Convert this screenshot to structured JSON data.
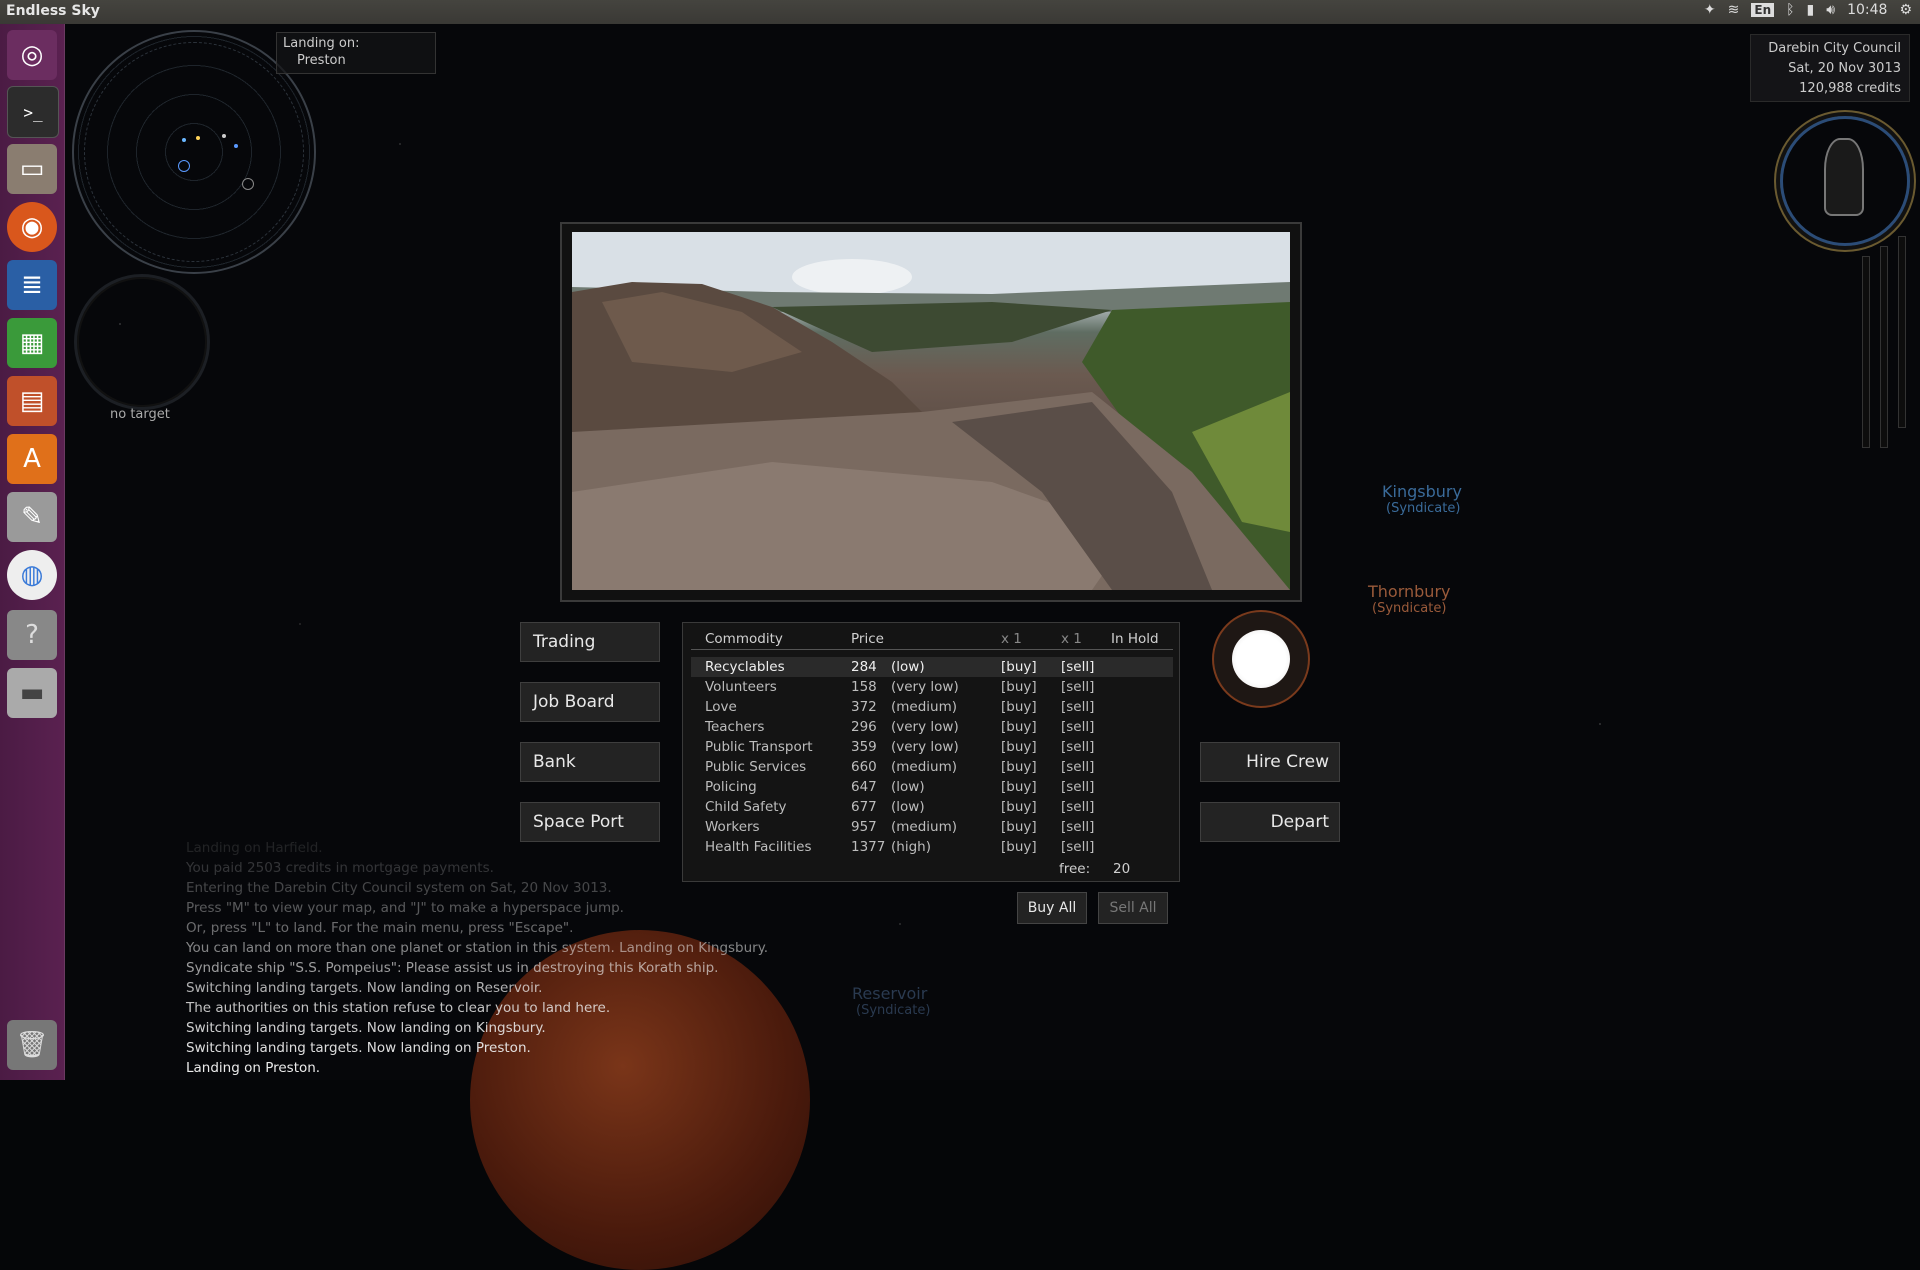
{
  "window": {
    "title": "Endless Sky"
  },
  "tray": {
    "keyboard": "En",
    "time": "10:48"
  },
  "launcher": {
    "items": [
      "ubuntu-home",
      "terminal",
      "files",
      "firefox",
      "writer",
      "calc",
      "impress",
      "software-center",
      "system-settings",
      "chrome",
      "help",
      "drive",
      "trash"
    ]
  },
  "hud": {
    "landing_label": "Landing on:",
    "landing_target": "Preston",
    "no_target": "no target",
    "system": "Darebin City Council",
    "date": "Sat, 20 Nov 3013",
    "credits": "120,988 credits"
  },
  "map_labels": [
    {
      "name": "Kingsbury",
      "gov": "(Syndicate)",
      "color": "#3a6b9a"
    },
    {
      "name": "Thornbury",
      "gov": "(Syndicate)",
      "color": "#9a5a3a"
    },
    {
      "name": "Reservoir",
      "gov": "(Syndicate)",
      "color": "#2a3a50"
    }
  ],
  "menu": {
    "trading": "Trading",
    "job_board": "Job Board",
    "bank": "Bank",
    "space_port": "Space Port",
    "hire_crew": "Hire Crew",
    "depart": "Depart"
  },
  "trade": {
    "headers": {
      "commodity": "Commodity",
      "price": "Price",
      "buy_qty": "x 1",
      "sell_qty": "x 1",
      "in_hold": "In Hold"
    },
    "rows": [
      {
        "name": "Recyclables",
        "price": "284",
        "level": "(low)",
        "buy": "[buy]",
        "sell": "[sell]"
      },
      {
        "name": "Volunteers",
        "price": "158",
        "level": "(very low)",
        "buy": "[buy]",
        "sell": "[sell]"
      },
      {
        "name": "Love",
        "price": "372",
        "level": "(medium)",
        "buy": "[buy]",
        "sell": "[sell]"
      },
      {
        "name": "Teachers",
        "price": "296",
        "level": "(very low)",
        "buy": "[buy]",
        "sell": "[sell]"
      },
      {
        "name": "Public Transport",
        "price": "359",
        "level": "(very low)",
        "buy": "[buy]",
        "sell": "[sell]"
      },
      {
        "name": "Public Services",
        "price": "660",
        "level": "(medium)",
        "buy": "[buy]",
        "sell": "[sell]"
      },
      {
        "name": "Policing",
        "price": "647",
        "level": "(low)",
        "buy": "[buy]",
        "sell": "[sell]"
      },
      {
        "name": "Child Safety",
        "price": "677",
        "level": "(low)",
        "buy": "[buy]",
        "sell": "[sell]"
      },
      {
        "name": "Workers",
        "price": "957",
        "level": "(medium)",
        "buy": "[buy]",
        "sell": "[sell]"
      },
      {
        "name": "Health Facilities",
        "price": "1377",
        "level": "(high)",
        "buy": "[buy]",
        "sell": "[sell]"
      }
    ],
    "free_label": "free:",
    "free_value": "20",
    "buy_all": "Buy All",
    "sell_all": "Sell All"
  },
  "log": [
    {
      "text": "Landing on Harfield.",
      "opacity": 0.12
    },
    {
      "text": "You paid 2503 credits in mortgage payments.",
      "opacity": 0.2
    },
    {
      "text": "Entering the Darebin City Council system on Sat, 20 Nov 3013.",
      "opacity": 0.28
    },
    {
      "text": "Press \"M\" to view your map, and \"J\" to make a hyperspace jump.",
      "opacity": 0.36
    },
    {
      "text": "Or, press \"L\" to land. For the main menu, press \"Escape\".",
      "opacity": 0.44
    },
    {
      "text": "You can land on more than one planet or station in this system. Landing on Kingsbury.",
      "opacity": 0.55
    },
    {
      "text": "Syndicate ship \"S.S. Pompeius\": Please assist us in destroying this Korath ship.",
      "opacity": 0.65
    },
    {
      "text": "Switching landing targets. Now landing on Reservoir.",
      "opacity": 0.74
    },
    {
      "text": "The authorities on this station refuse to clear you to land here.",
      "opacity": 0.82
    },
    {
      "text": "Switching landing targets. Now landing on Kingsbury.",
      "opacity": 0.88
    },
    {
      "text": "Switching landing targets. Now landing on Preston.",
      "opacity": 0.94
    },
    {
      "text": "Landing on Preston.",
      "opacity": 1.0
    }
  ]
}
